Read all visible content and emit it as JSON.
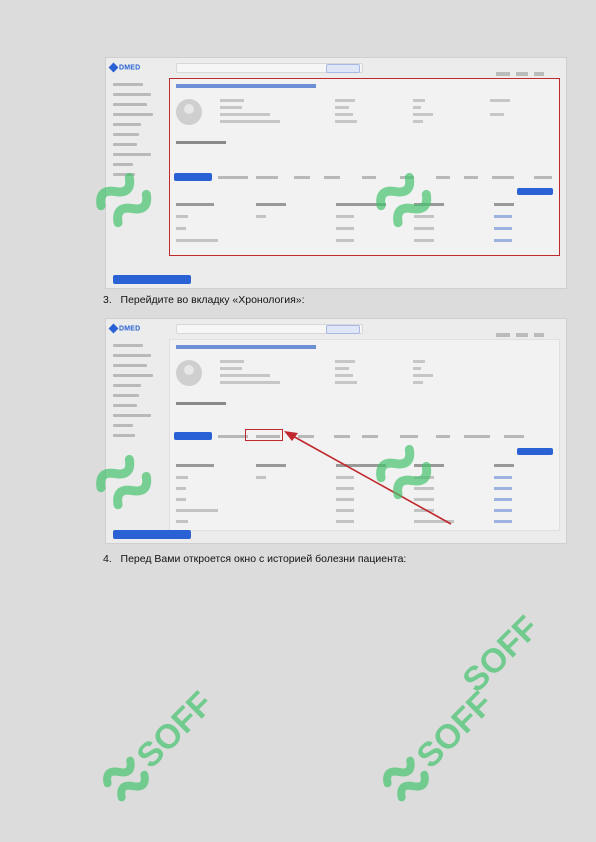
{
  "steps": [
    {
      "number": "3.",
      "text": "Перейдите во вкладку «Хронология»:"
    },
    {
      "number": "4.",
      "text": "Перед Вами откроется окно с историей болезни пациента:"
    }
  ],
  "screenshots": [
    {
      "logo": "DMED",
      "highlight": "patient-card",
      "active_tab": "first"
    },
    {
      "logo": "DMED",
      "highlight": "chronology-tab",
      "active_tab": "first"
    }
  ],
  "watermark": {
    "text": "SOFF",
    "color": "#3fc06a"
  },
  "colors": {
    "highlight": "#c0282e",
    "accent": "#2a62d6"
  }
}
